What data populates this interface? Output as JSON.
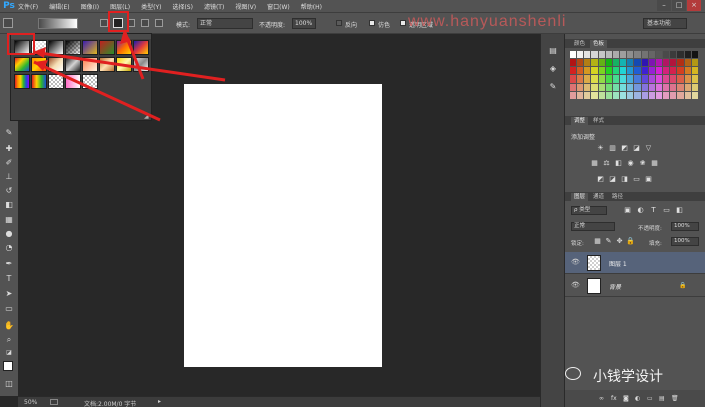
{
  "app": {
    "logo": "Ps"
  },
  "menu": [
    "文件(F)",
    "编辑(E)",
    "图像(I)",
    "图层(L)",
    "类型(Y)",
    "选择(S)",
    "滤镜(T)",
    "视图(V)",
    "窗口(W)",
    "帮助(H)"
  ],
  "window_controls": {
    "minimize": "–",
    "maximize": "□",
    "close": "×"
  },
  "options": {
    "mode_label": "模式:",
    "mode_value": "正常",
    "opacity_label": "不透明度:",
    "opacity_value": "100%",
    "reverse_label": "反向",
    "dither_label": "仿色",
    "transparency_label": "透明区域",
    "workspace_value": "基本功能",
    "watermark": "www.hanyuanshenli"
  },
  "canvas": {
    "background": "#ffffff"
  },
  "status": {
    "zoom": "50%",
    "doc_info": "文档:2.00M/0 字节"
  },
  "panels": {
    "color_tab": "颜色",
    "swatches_tab": "色板",
    "adjust_tab": "调整",
    "styles_tab": "样式",
    "adjust_title": "添加调整",
    "layers_tab": "图层",
    "channels_tab": "通道",
    "paths_tab": "路径",
    "filter_kind": "ρ 类型",
    "blend_mode": "正常",
    "opacity_label": "不透明度:",
    "opacity_value": "100%",
    "lock_label": "锁定:",
    "fill_label": "填充:",
    "fill_value": "100%"
  },
  "layers": [
    {
      "name": "图层 1",
      "selected": true
    },
    {
      "name": "背景",
      "selected": false
    }
  ],
  "branding": {
    "text": "小钱学设计"
  },
  "annotation_color": "#e02020",
  "accent_color": "#31a8ff"
}
